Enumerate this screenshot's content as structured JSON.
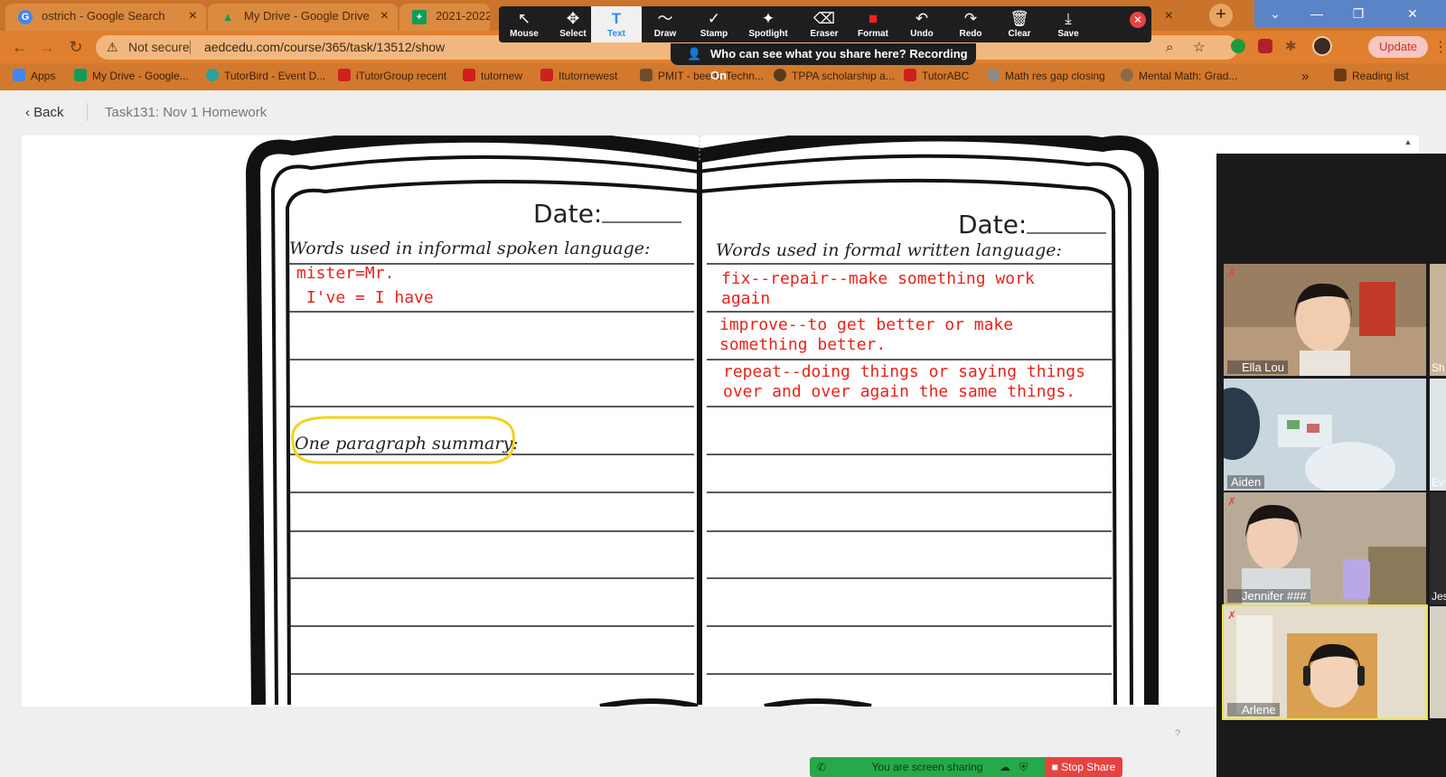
{
  "browser": {
    "tabs": [
      {
        "title": "ostrich - Google Search",
        "icon": "G",
        "color": "#4285f4"
      },
      {
        "title": "My Drive - Google Drive",
        "icon": "▲",
        "color": "#0f9d58"
      },
      {
        "title": "2021-2022 S",
        "icon": "+",
        "color": "#0f9d58"
      }
    ],
    "security": "Not secure",
    "url": "aedcedu.com/course/365/task/13512/show",
    "update_label": "Update",
    "bookmarks": [
      {
        "label": "Apps",
        "color": "#4285f4"
      },
      {
        "label": "My Drive - Google...",
        "color": "#0f9d58"
      },
      {
        "label": "TutorBird - Event D...",
        "color": "#2aa0a0"
      },
      {
        "label": "iTutorGroup recent",
        "color": "#d01f1f"
      },
      {
        "label": "tutornew",
        "color": "#d01f1f"
      },
      {
        "label": "Itutornewest",
        "color": "#d01f1f"
      },
      {
        "label": "PMIT - beetle Techn...",
        "color": "#6b4e2e"
      },
      {
        "label": "TPPA scholarship a...",
        "color": "#5a3a1a"
      },
      {
        "label": "TutorABC",
        "color": "#d01f1f"
      },
      {
        "label": "Math res gap closing",
        "color": "#8a8a8a"
      },
      {
        "label": "Mental Math: Grad...",
        "color": "#8a6a4a"
      },
      {
        "label": "Reading list",
        "color": "#6b3a12"
      }
    ]
  },
  "page": {
    "back_label": "Back",
    "task_title": "Task131:  Nov 1 Homework"
  },
  "worksheet": {
    "left_date": "Date:",
    "right_date": "Date:",
    "left_header": "Words used in informal spoken language:",
    "right_header": "Words used in formal written language:",
    "summary_label": "One paragraph summary:",
    "left_notes": [
      "mister=Mr.",
      " I've = I have"
    ],
    "right_notes": [
      "fix--repair--make something work\nagain",
      "improve--to get better or make\nsomething better.",
      "repeat--doing things or saying things\nover and over again the same things."
    ]
  },
  "zoom_toolbar": {
    "tools": [
      {
        "label": "Mouse",
        "icon": "↖"
      },
      {
        "label": "Select",
        "icon": "✥"
      },
      {
        "label": "Text",
        "icon": "T"
      },
      {
        "label": "Draw",
        "icon": "〜"
      },
      {
        "label": "Stamp",
        "icon": "✓"
      },
      {
        "label": "Spotlight",
        "icon": "✦"
      },
      {
        "label": "Eraser",
        "icon": "⌫"
      },
      {
        "label": "Format",
        "icon": "■"
      },
      {
        "label": "Undo",
        "icon": "↶"
      },
      {
        "label": "Redo",
        "icon": "↷"
      },
      {
        "label": "Clear",
        "icon": "🗑"
      },
      {
        "label": "Save",
        "icon": "⤓"
      }
    ],
    "active_tool": "Text",
    "share_notice": "Who can see what you share here? Recording On"
  },
  "participants": [
    {
      "name": "Ella Lou",
      "bg": "#9a7e62",
      "skin": "#f1cdb0"
    },
    {
      "name": "Aiden",
      "bg": "#b8c9d4",
      "skin": "#d8e4ea"
    },
    {
      "name": "Jennifer ###",
      "bg": "#b9aa98",
      "skin": "#f0cdb4"
    },
    {
      "name": "Arlene",
      "bg": "#d8c8a8",
      "skin": "#f2d2b8"
    }
  ],
  "side_participants": [
    "Sh",
    "Ev",
    "Jes",
    ""
  ],
  "share_bar": {
    "status": "You are screen sharing",
    "stop_label": "Stop Share"
  }
}
